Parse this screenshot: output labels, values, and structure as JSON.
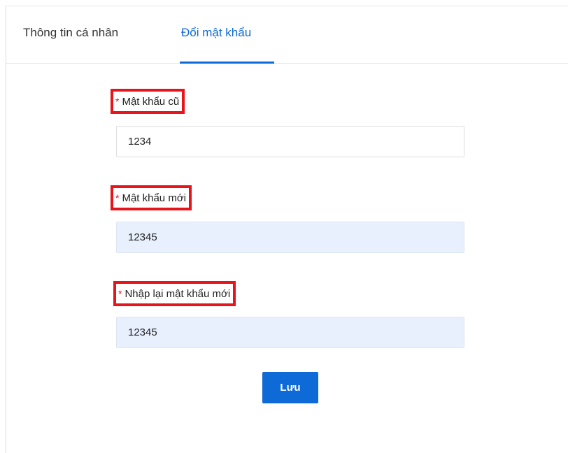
{
  "tabs": [
    {
      "label": "Thông tin cá nhân",
      "active": false
    },
    {
      "label": "Đổi mật khẩu",
      "active": true
    }
  ],
  "required_marker": "*",
  "form": {
    "old_password": {
      "label": "Mật khẩu cũ",
      "value": "1234"
    },
    "new_password": {
      "label": "Mật khẩu mới",
      "value": "12345"
    },
    "confirm_password": {
      "label": "Nhập lại mật khẩu mới",
      "value": "12345"
    }
  },
  "save_button": {
    "label": "Lưu"
  },
  "colors": {
    "accent": "#0d6ad6",
    "highlight_border": "#e8141b",
    "required": "#e8141b",
    "autofill_background": "#e8f0fe"
  }
}
